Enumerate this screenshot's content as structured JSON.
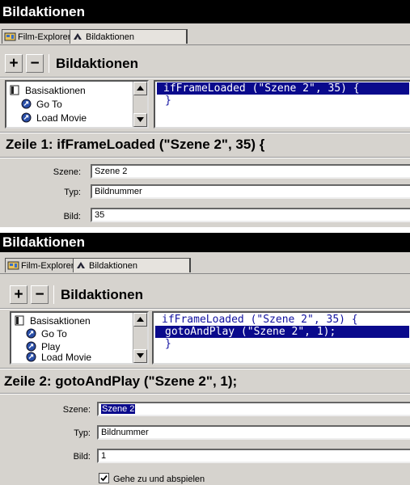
{
  "panel1": {
    "title": "Bildaktionen",
    "tabs": [
      "Film-Explorer",
      "Bildaktionen"
    ],
    "toolbar": {
      "add": "+",
      "remove": "−",
      "title": "Bildaktionen"
    },
    "list": [
      "Basisaktionen",
      "Go To",
      "Load Movie"
    ],
    "code": [
      "ifFrameLoaded (\"Szene 2\", 35) {",
      "}"
    ],
    "status": "Zeile 1: ifFrameLoaded (\"Szene 2\", 35) {",
    "fields": [
      {
        "label": "Szene:",
        "value": "Szene 2"
      },
      {
        "label": "Typ:",
        "value": "Bildnummer"
      },
      {
        "label": "Bild:",
        "value": "35"
      }
    ]
  },
  "panel2": {
    "title": "Bildaktionen",
    "tabs": [
      "Film-Explorer",
      "Bildaktionen"
    ],
    "toolbar": {
      "add": "+",
      "remove": "−",
      "title": "Bildaktionen"
    },
    "list": [
      "Basisaktionen",
      "Go To",
      "Play",
      "Load Movie"
    ],
    "code": [
      "ifFrameLoaded (\"Szene 2\", 35) {",
      "gotoAndPlay (\"Szene 2\", 1);",
      "}"
    ],
    "status": "Zeile 2: gotoAndPlay (\"Szene 2\", 1);",
    "fields": [
      {
        "label": "Szene:",
        "value": "Szene 2"
      },
      {
        "label": "Typ:",
        "value": "Bildnummer"
      },
      {
        "label": "Bild:",
        "value": "1"
      }
    ],
    "checkbox": {
      "label": "Gehe zu und abspielen",
      "checked": true
    }
  }
}
